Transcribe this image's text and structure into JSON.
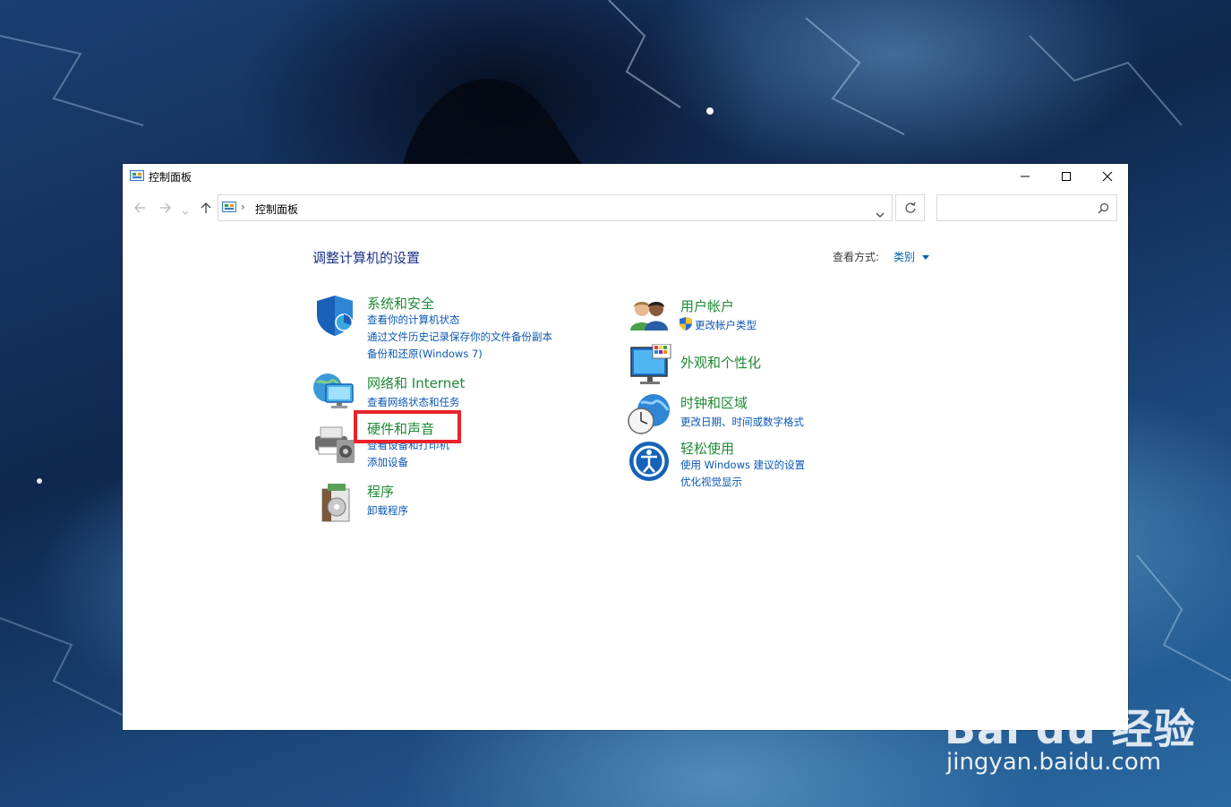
{
  "window": {
    "title": "控制面板",
    "minimize_icon": "minimize-icon",
    "maximize_icon": "maximize-icon",
    "close_icon": "close-icon"
  },
  "address_bar": {
    "breadcrumb": "控制面板",
    "separator": "›",
    "search_placeholder": ""
  },
  "main": {
    "heading": "调整计算机的设置",
    "view_by_label": "查看方式:",
    "view_by_value": "类别"
  },
  "categories_left": [
    {
      "title": "系统和安全",
      "links": [
        "查看你的计算机状态",
        "通过文件历史记录保存你的文件备份副本",
        "备份和还原(Windows 7)"
      ],
      "icon": "shield-icon"
    },
    {
      "title": "网络和 Internet",
      "links": [
        "查看网络状态和任务"
      ],
      "icon": "network-icon"
    },
    {
      "title": "硬件和声音",
      "links": [
        "查看设备和打印机",
        "添加设备"
      ],
      "icon": "printer-icon"
    },
    {
      "title": "程序",
      "links": [
        "卸载程序"
      ],
      "icon": "programs-icon"
    }
  ],
  "categories_right": [
    {
      "title": "用户帐户",
      "links": [
        "更改帐户类型"
      ],
      "icon": "users-icon"
    },
    {
      "title": "外观和个性化",
      "links": [],
      "icon": "appearance-icon"
    },
    {
      "title": "时钟和区域",
      "links": [
        "更改日期、时间或数字格式"
      ],
      "icon": "clock-globe-icon"
    },
    {
      "title": "轻松使用",
      "links": [
        "使用 Windows 建议的设置",
        "优化视觉显示"
      ],
      "icon": "ease-of-access-icon"
    }
  ],
  "watermark": {
    "logo_text": "Bai du 经验",
    "url": "jingyan.baidu.com"
  },
  "colors": {
    "category_title": "#1e8a36",
    "link": "#0b57b4",
    "heading": "#1e3287",
    "highlight": "#e8232a"
  }
}
